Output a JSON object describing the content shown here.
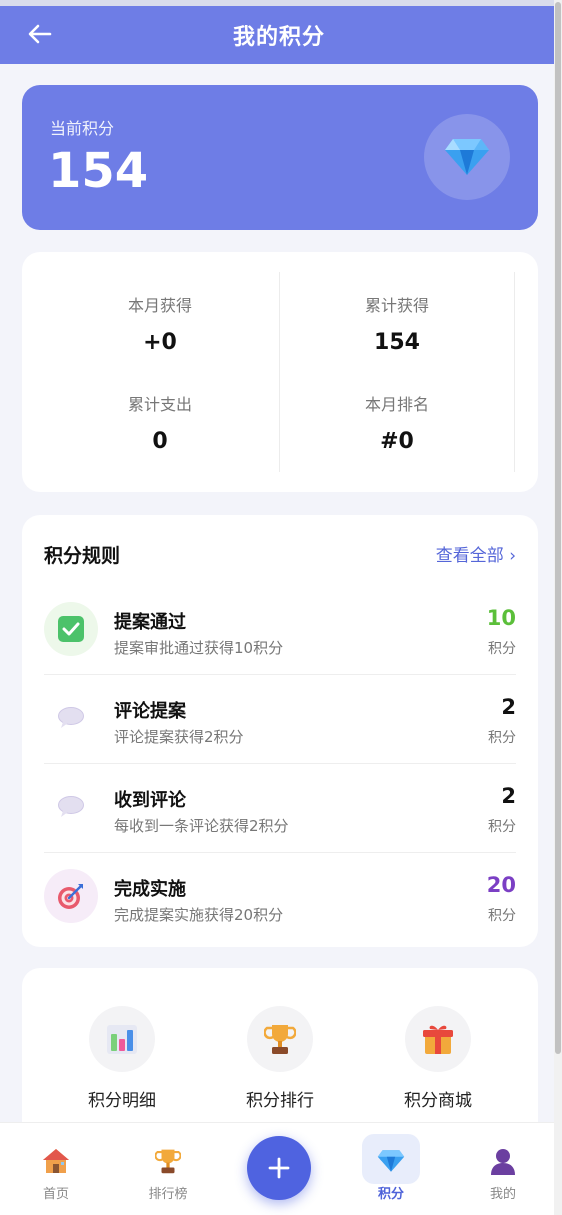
{
  "header": {
    "title": "我的积分",
    "back_icon": "arrow-left-icon"
  },
  "hero": {
    "label": "当前积分",
    "value": "154",
    "icon": "diamond-icon"
  },
  "stats": [
    {
      "label": "本月获得",
      "value": "+0"
    },
    {
      "label": "累计获得",
      "value": "154"
    },
    {
      "label": "累计支出",
      "value": "0"
    },
    {
      "label": "本月排名",
      "value": "#0"
    }
  ],
  "rules": {
    "title": "积分规则",
    "more": "查看全部 ›",
    "items": [
      {
        "name": "提案通过",
        "desc": "提案审批通过获得10积分",
        "points": "10",
        "unit": "积分",
        "points_color": "#5bbf3a",
        "icon": "check-box-icon"
      },
      {
        "name": "评论提案",
        "desc": "评论提案获得2积分",
        "points": "2",
        "unit": "积分",
        "points_color": "#111111",
        "icon": "speech-bubble-icon"
      },
      {
        "name": "收到评论",
        "desc": "每收到一条评论获得2积分",
        "points": "2",
        "unit": "积分",
        "points_color": "#111111",
        "icon": "speech-bubble-icon"
      },
      {
        "name": "完成实施",
        "desc": "完成提案实施获得20积分",
        "points": "20",
        "unit": "积分",
        "points_color": "#7b3fc4",
        "icon": "target-icon"
      }
    ]
  },
  "actions": [
    {
      "label": "积分明细",
      "icon": "bar-chart-icon"
    },
    {
      "label": "积分排行",
      "icon": "trophy-icon"
    },
    {
      "label": "积分商城",
      "icon": "gift-icon"
    }
  ],
  "tabbar": {
    "tabs": [
      {
        "label": "首页",
        "icon": "house-icon"
      },
      {
        "label": "排行榜",
        "icon": "trophy-icon"
      },
      {
        "label": "积分",
        "icon": "diamond-icon",
        "active": true
      },
      {
        "label": "我的",
        "icon": "user-icon"
      }
    ],
    "fab_icon": "plus-icon"
  },
  "colors": {
    "accent": "#6e7de6",
    "primary": "#4f63e0",
    "background": "#f3f4fa"
  }
}
